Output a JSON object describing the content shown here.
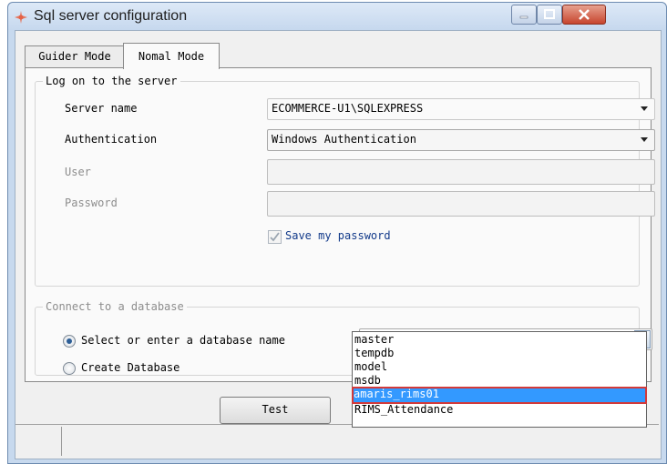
{
  "window": {
    "title": "Sql server configuration",
    "controls": {
      "minimize": "minimize",
      "maximize": "maximize",
      "close": "close"
    }
  },
  "tabs": [
    {
      "label": "Guider Mode",
      "active": false
    },
    {
      "label": "Nomal Mode",
      "active": true
    }
  ],
  "logon_group": {
    "label": "Log on to the server",
    "server_name_label": "Server name",
    "server_name_value": "ECOMMERCE-U1\\SQLEXPRESS",
    "authentication_label": "Authentication",
    "authentication_value": "Windows Authentication",
    "user_label": "User",
    "user_value": "",
    "password_label": "Password",
    "password_value": "",
    "save_password_label": "Save my password",
    "save_password_checked": true
  },
  "database_group": {
    "label": "Connect to a database",
    "select_option_label": "Select or enter a database name",
    "create_option_label": "Create Database",
    "selected_option": "select",
    "database_value": "",
    "dropdown_options": [
      "master",
      "tempdb",
      "model",
      "msdb",
      "amaris_rims01",
      "RIMS_Attendance"
    ],
    "highlighted_option": "amaris_rims01"
  },
  "buttons": {
    "test_label": "Test"
  },
  "colors": {
    "selection": "#3399ff",
    "highlight_outline": "#d33a3a",
    "titlebar": "#c7d9ee"
  }
}
